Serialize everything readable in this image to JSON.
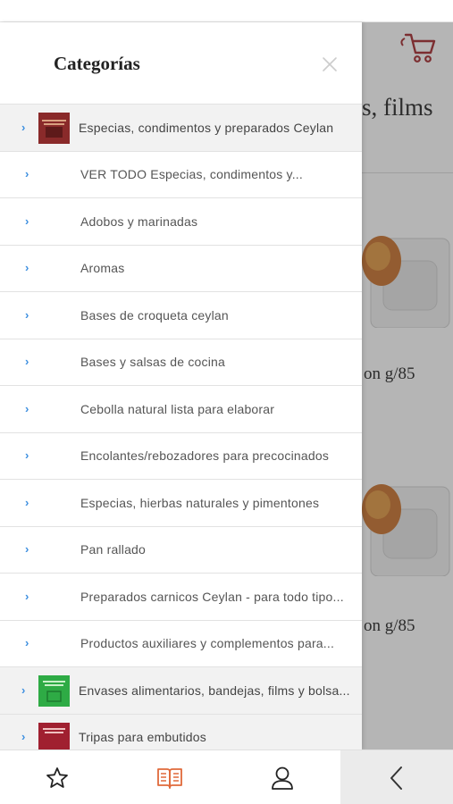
{
  "background_page": {
    "title_fragment": "s, films",
    "product_text_1": "on g/85",
    "product_text_2": "on g/85"
  },
  "drawer": {
    "title": "Categorías",
    "categories": [
      {
        "label": "Especias, condimentos y preparados Ceylan",
        "level": "parent",
        "thumb_color": "#8a2a2a"
      },
      {
        "label": "VER TODO Especias, condimentos y...",
        "level": "child"
      },
      {
        "label": "Adobos  y marinadas",
        "level": "child"
      },
      {
        "label": "Aromas",
        "level": "child"
      },
      {
        "label": "Bases de croqueta ceylan",
        "level": "child"
      },
      {
        "label": "Bases y salsas de cocina",
        "level": "child"
      },
      {
        "label": "Cebolla  natural lista para elaborar",
        "level": "child"
      },
      {
        "label": "Encolantes/rebozadores para precocinados",
        "level": "child"
      },
      {
        "label": "Especias, hierbas naturales y pimentones",
        "level": "child"
      },
      {
        "label": "Pan rallado",
        "level": "child"
      },
      {
        "label": "Preparados carnicos Ceylan - para todo tipo...",
        "level": "child"
      },
      {
        "label": "Productos auxiliares y complementos para...",
        "level": "child"
      },
      {
        "label": "Envases alimentarios, bandejas, films y bolsa...",
        "level": "parent",
        "thumb_color": "#2eab45"
      },
      {
        "label": "Tripas para embutidos",
        "level": "parent",
        "thumb_color": "#a02030"
      }
    ]
  },
  "tabbar": {
    "items": [
      {
        "name": "favorites",
        "icon": "star-icon",
        "active": false
      },
      {
        "name": "catalog",
        "icon": "book-icon",
        "active": true
      },
      {
        "name": "account",
        "icon": "user-icon",
        "active": false
      },
      {
        "name": "back",
        "icon": "chevron-left-icon",
        "active": false
      }
    ]
  },
  "colors": {
    "accent": "#e0693a",
    "brand_red": "#a3262b",
    "chevron_blue": "#3d8fe0",
    "parent_row_bg": "#f2f2f2"
  }
}
